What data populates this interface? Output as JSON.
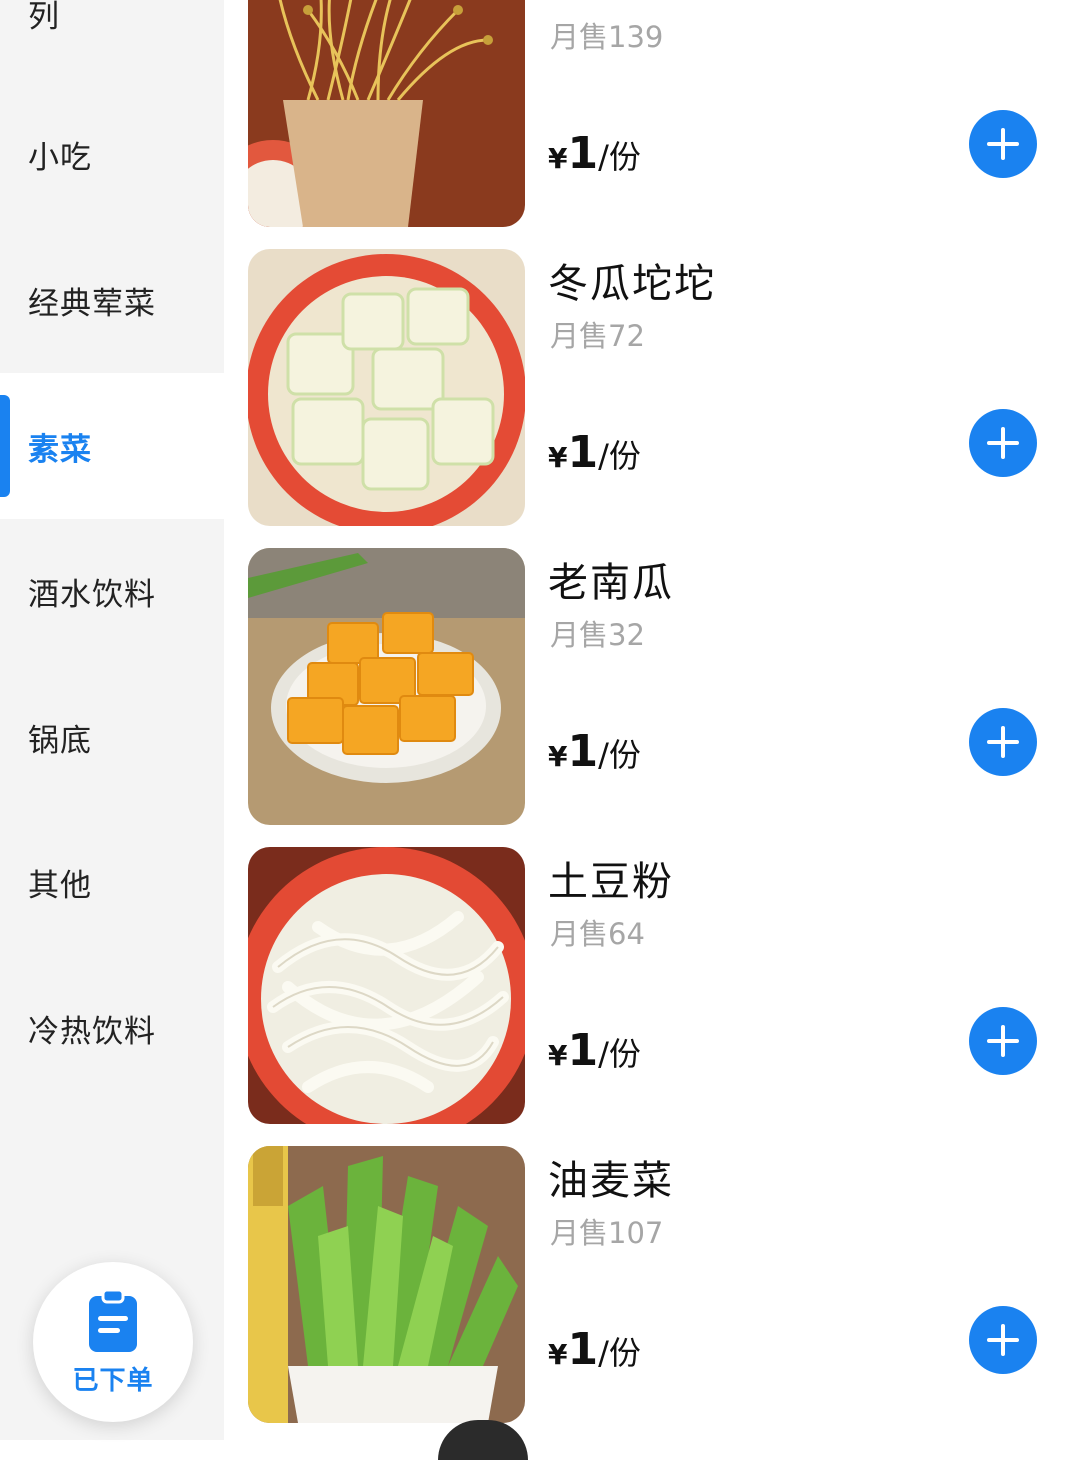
{
  "sidebar": {
    "items": [
      {
        "label": "列"
      },
      {
        "label": "小吃"
      },
      {
        "label": "经典荤菜"
      },
      {
        "label": "素菜",
        "active": true
      },
      {
        "label": "酒水饮料"
      },
      {
        "label": "锅底"
      },
      {
        "label": "其他"
      },
      {
        "label": "冷热饮料"
      }
    ]
  },
  "products": [
    {
      "name": "",
      "sales": "月售139",
      "currency": "¥",
      "price": "1",
      "unit": "/份",
      "icon": "plus-icon"
    },
    {
      "name": "冬瓜坨坨",
      "sales": "月售72",
      "currency": "¥",
      "price": "1",
      "unit": "/份",
      "icon": "plus-icon"
    },
    {
      "name": "老南瓜",
      "sales": "月售32",
      "currency": "¥",
      "price": "1",
      "unit": "/份",
      "icon": "plus-icon"
    },
    {
      "name": "土豆粉",
      "sales": "月售64",
      "currency": "¥",
      "price": "1",
      "unit": "/份",
      "icon": "plus-icon"
    },
    {
      "name": "油麦菜",
      "sales": "月售107",
      "currency": "¥",
      "price": "1",
      "unit": "/份",
      "icon": "plus-icon"
    }
  ],
  "ordered_button": {
    "label": "已下单",
    "icon": "clipboard-icon"
  },
  "colors": {
    "accent": "#1a82f0",
    "sidebar_bg": "#f4f4f4",
    "muted": "#a6a6a6"
  }
}
